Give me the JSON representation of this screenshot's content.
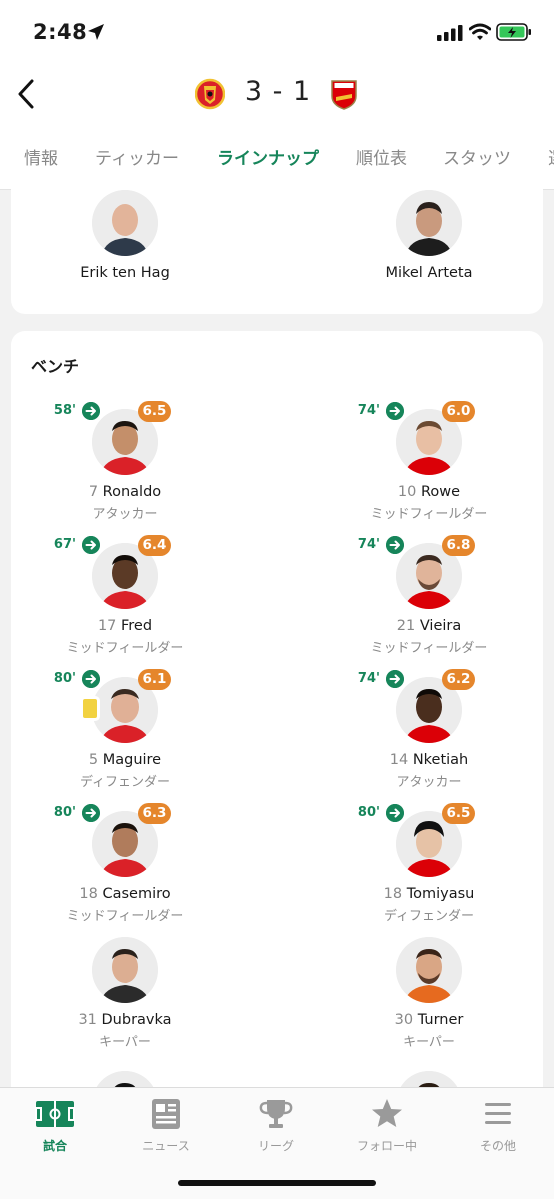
{
  "status_bar": {
    "time": "2:48"
  },
  "match": {
    "score": "3 - 1",
    "home_crest": "manchester-united-crest",
    "away_crest": "arsenal-crest"
  },
  "tabs": [
    "情報",
    "ティッカー",
    "ラインナップ",
    "順位表",
    "スタッツ",
    "選"
  ],
  "managers": {
    "home": {
      "name": "Erik ten Hag"
    },
    "away": {
      "name": "Mikel Arteta"
    }
  },
  "bench": {
    "title": "ベンチ",
    "home": [
      {
        "minute": "58'",
        "rating": "6.5",
        "number": "7",
        "name": "Ronaldo",
        "role": "アタッカー"
      },
      {
        "minute": "67'",
        "rating": "6.4",
        "number": "17",
        "name": "Fred",
        "role": "ミッドフィールダー"
      },
      {
        "minute": "80'",
        "rating": "6.1",
        "number": "5",
        "name": "Maguire",
        "role": "ディフェンダー",
        "yellow_card": true
      },
      {
        "minute": "80'",
        "rating": "6.3",
        "number": "18",
        "name": "Casemiro",
        "role": "ミッドフィールダー"
      },
      {
        "number": "31",
        "name": "Dubravka",
        "role": "キーパー"
      }
    ],
    "away": [
      {
        "minute": "74'",
        "rating": "6.0",
        "number": "10",
        "name": "Rowe",
        "role": "ミッドフィールダー"
      },
      {
        "minute": "74'",
        "rating": "6.8",
        "number": "21",
        "name": "Vieira",
        "role": "ミッドフィールダー"
      },
      {
        "minute": "74'",
        "rating": "6.2",
        "number": "14",
        "name": "Nketiah",
        "role": "アタッカー"
      },
      {
        "minute": "80'",
        "rating": "6.5",
        "number": "18",
        "name": "Tomiyasu",
        "role": "ディフェンダー"
      },
      {
        "number": "30",
        "name": "Turner",
        "role": "キーパー"
      }
    ]
  },
  "bottom_nav": [
    {
      "label": "試合",
      "icon": "pitch-icon",
      "active": true
    },
    {
      "label": "ニュース",
      "icon": "news-icon"
    },
    {
      "label": "リーグ",
      "icon": "trophy-icon"
    },
    {
      "label": "フォロー中",
      "icon": "star-icon"
    },
    {
      "label": "その他",
      "icon": "menu-icon"
    }
  ],
  "colors": {
    "accent": "#16855a",
    "rating": "#e5862c",
    "yellow_card": "#f2d240"
  }
}
